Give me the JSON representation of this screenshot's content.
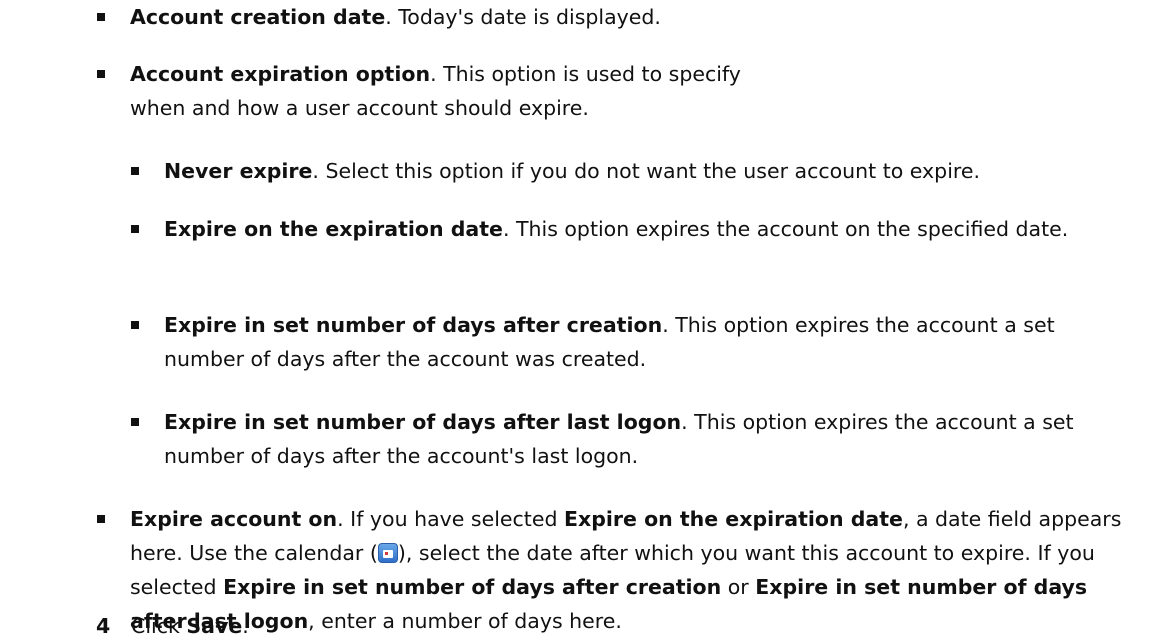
{
  "items": {
    "creation_date": {
      "term": "Account creation date",
      "desc": ". Today's date is displayed."
    },
    "expiration_option": {
      "term": "Account expiration option",
      "desc": ". This option is used to specify when and how a user account should expire.",
      "sub": [
        {
          "term": "Never expire",
          "desc": ". Select this option if you do not want the user account to expire."
        },
        {
          "term": "Expire on the expiration date",
          "desc": ". This option expires the account on the specified date."
        },
        {
          "term": "Expire in set number of days after creation",
          "desc": ". This option expires the account a set number of days after the account was created."
        },
        {
          "term": "Expire in set number of days after last logon",
          "desc": ". This option expires the account a set number of days after the account's last logon."
        }
      ]
    },
    "expire_on": {
      "term": "Expire account on",
      "t1": ". If you have selected ",
      "b1": "Expire on the expiration date",
      "t2": ", a date field appears here. Use the calendar (",
      "t3": "), select the date after which you want this account to expire. If you selected ",
      "b2": "Expire in set number of days after creation",
      "t4": " or ",
      "b3": "Expire in set number of days after last logon",
      "t5": ", enter a number of days here."
    }
  },
  "step": {
    "number": "4",
    "prefix": "Click ",
    "button": "Save",
    "suffix": "."
  },
  "icons": {
    "calendar": "calendar-icon"
  }
}
